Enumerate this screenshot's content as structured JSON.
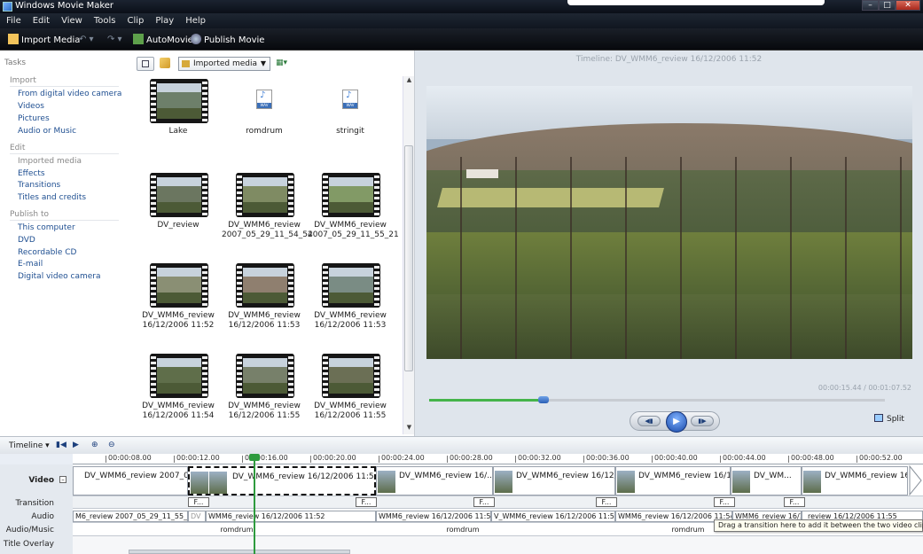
{
  "window": {
    "title": "Windows Movie Maker"
  },
  "menu": [
    "File",
    "Edit",
    "View",
    "Tools",
    "Clip",
    "Play",
    "Help"
  ],
  "toolbar": {
    "import": "Import Media",
    "automovie": "AutoMovie",
    "publish": "Publish Movie"
  },
  "tasks": {
    "header": "Tasks",
    "sections": [
      {
        "title": "Import",
        "items": [
          "From digital video camera",
          "Videos",
          "Pictures",
          "Audio or Music"
        ]
      },
      {
        "title": "Edit",
        "items": [
          "Imported media",
          "Effects",
          "Transitions",
          "Titles and credits"
        ]
      },
      {
        "title": "Publish to",
        "items": [
          "This computer",
          "DVD",
          "Recordable CD",
          "E-mail",
          "Digital video camera"
        ]
      }
    ]
  },
  "collection": {
    "dropdown": "Imported media",
    "clips": [
      {
        "l1": "Lake",
        "l2": "",
        "type": "video",
        "color": "#6d7f6a"
      },
      {
        "l1": "romdrum",
        "l2": "",
        "type": "audio",
        "color": ""
      },
      {
        "l1": "stringit",
        "l2": "",
        "type": "audio",
        "color": ""
      },
      {
        "l1": "DV_review",
        "l2": "",
        "type": "video",
        "color": "#6b7660"
      },
      {
        "l1": "DV_WMM6_review",
        "l2": "2007_05_29_11_54_54",
        "type": "video",
        "color": "#7f8b63"
      },
      {
        "l1": "DV_WMM6_review",
        "l2": "2007_05_29_11_55_21",
        "type": "video",
        "color": "#829a66"
      },
      {
        "l1": "DV_WMM6_review",
        "l2": "16/12/2006 11:52",
        "type": "video",
        "color": "#8a8f74"
      },
      {
        "l1": "DV_WMM6_review",
        "l2": "16/12/2006 11:53",
        "type": "video",
        "color": "#8f7f6f"
      },
      {
        "l1": "DV_WMM6_review",
        "l2": "16/12/2006 11:53",
        "type": "video",
        "color": "#7a8c84"
      },
      {
        "l1": "DV_WMM6_review",
        "l2": "16/12/2006 11:54",
        "type": "video",
        "color": "#5f6e4a"
      },
      {
        "l1": "DV_WMM6_review",
        "l2": "16/12/2006 11:55",
        "type": "video",
        "color": "#77806a"
      },
      {
        "l1": "DV_WMM6_review",
        "l2": "16/12/2006 11:55",
        "type": "video",
        "color": "#6b6f55"
      }
    ]
  },
  "preview": {
    "title": "Timeline: DV_WMM6_review 16/12/2006 11:52",
    "timecode": "00:00:15.44 / 00:01:07.52",
    "progress": 0.25,
    "split": "Split"
  },
  "timeline": {
    "label": "Timeline",
    "ruler": [
      "00:00:08.00",
      "00:00:12.00",
      "00:00:16.00",
      "00:00:20.00",
      "00:00:24.00",
      "00:00:28.00",
      "00:00:32.00",
      "00:00:36.00",
      "00:00:40.00",
      "00:00:44.00",
      "00:00:48.00",
      "00:00:52.00"
    ],
    "tracks": {
      "video": "Video",
      "transition": "Transition",
      "audio": "Audio",
      "music": "Audio/Music",
      "title": "Title Overlay"
    },
    "video_clips": [
      "DV_WMM6_review 2007_05_29_1...",
      "DV_WMM6_review 16/12/2006 11:52",
      "DV_WMM6_review 16/...",
      "DV_WMM6_review 16/12/...",
      "DV_WMM6_review 16/12/...",
      "DV_WM...",
      "DV_WMM6_review 16/12/2006 11:..."
    ],
    "transitions": [
      "F...",
      "F...",
      "F...",
      "F...",
      "F...",
      "F..."
    ],
    "audio_clips": [
      "M6_review 2007_05_29_11_55_21",
      "DV",
      "WMM6_review 16/12/2006 11:52",
      "WMM6_review 16/12/2006 11:53",
      "V_WMM6_review 16/12/2006 11:53",
      "WMM6_review 16/12/2006 11:54",
      "WMM6_review 16/12/...",
      "_review 16/12/2006 11:55"
    ],
    "music_clips": [
      "romdrum",
      "romdrum",
      "romdrum"
    ],
    "tooltip": "Drag a transition here to add it between the two video clips."
  }
}
